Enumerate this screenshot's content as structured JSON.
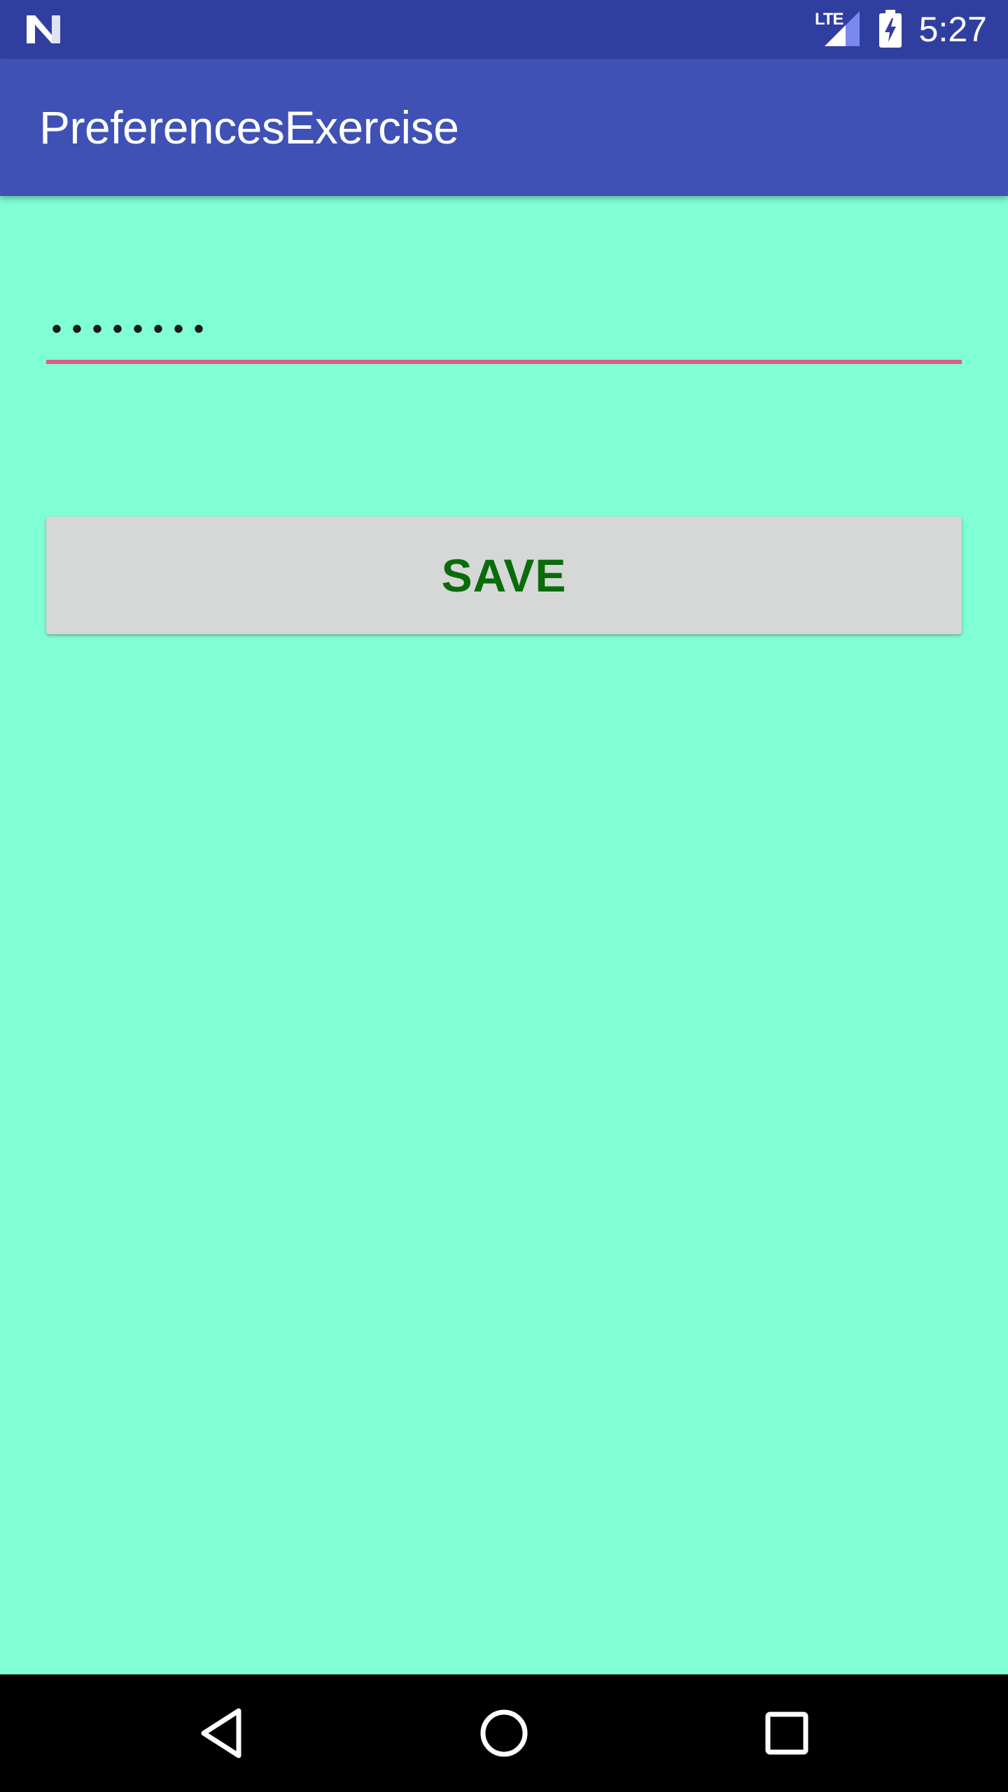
{
  "status_bar": {
    "network_label": "LTE",
    "time": "5:27",
    "icons": [
      "android-n-icon",
      "signal-icon",
      "battery-charging-icon"
    ]
  },
  "toolbar": {
    "title": "PreferencesExercise",
    "color": "#3f51b5"
  },
  "password_field": {
    "value": "••••••••",
    "underline_color": "#e15b86"
  },
  "save_button": {
    "label": "SAVE",
    "text_color": "#0a6b0a",
    "background": "#d6d7d7"
  },
  "background_color": "#80ffd4",
  "nav_bar": {
    "icons": [
      "back-icon",
      "home-icon",
      "recents-icon"
    ]
  }
}
